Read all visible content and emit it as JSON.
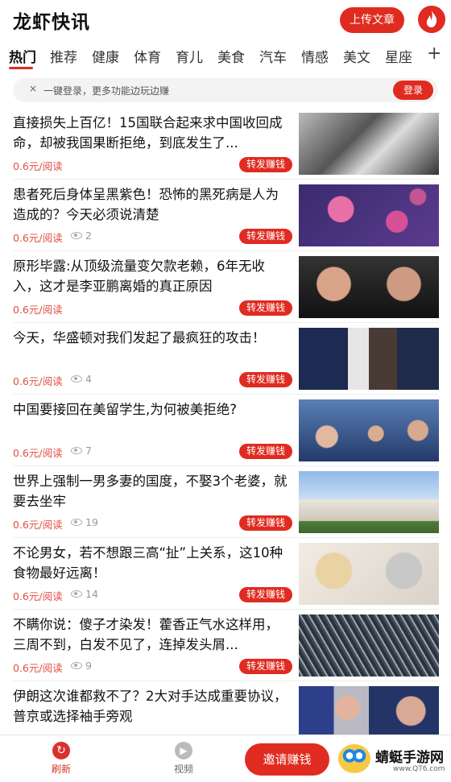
{
  "header": {
    "app_title": "龙虾快讯",
    "upload_label": "上传文章",
    "fire_icon": "fire-icon"
  },
  "tabs": {
    "items": [
      "热门",
      "推荐",
      "健康",
      "体育",
      "育儿",
      "美食",
      "汽车",
      "情感",
      "美文",
      "星座"
    ],
    "active_index": 0,
    "add_label": "+"
  },
  "login_bar": {
    "close_label": "×",
    "text": "一键登录，更多功能边玩边赚",
    "button_label": "登录"
  },
  "feed": {
    "share_label": "转发赚钱",
    "items": [
      {
        "title": "直接损失上百亿！15国联合起来求中国收回成命，却被我国果断拒绝，到底发生了...",
        "meta": "0.6元/阅读",
        "views": ""
      },
      {
        "title": "患者死后身体呈黑紫色！恐怖的黑死病是人为造成的？今天必须说清楚",
        "meta": "0.6元/阅读",
        "views": "2"
      },
      {
        "title": "原形毕露:从顶级流量变欠款老赖，6年无收入，这才是李亚鹏离婚的真正原因",
        "meta": "0.6元/阅读",
        "views": ""
      },
      {
        "title": "今天，华盛顿对我们发起了最疯狂的攻击！",
        "meta": "0.6元/阅读",
        "views": "4"
      },
      {
        "title": "中国要接回在美留学生,为何被美拒绝?",
        "meta": "0.6元/阅读",
        "views": "7"
      },
      {
        "title": "世界上强制一男多妻的国度，不娶3个老婆，就要去坐牢",
        "meta": "0.6元/阅读",
        "views": "19"
      },
      {
        "title": "不论男女，若不想跟三高“扯”上关系，这10种食物最好远离！",
        "meta": "0.6元/阅读",
        "views": "14"
      },
      {
        "title": "不瞒你说：傻子才染发！藿香正气水这样用，三周不到，白发不见了，连掉发头屑...",
        "meta": "0.6元/阅读",
        "views": "9"
      },
      {
        "title": "伊朗这次谁都救不了？2大对手达成重要协议，普京或选择袖手旁观",
        "meta": "",
        "views": ""
      }
    ]
  },
  "bottom_nav": {
    "refresh_label": "刷新",
    "refresh_icon": "refresh-icon",
    "video_label": "视频",
    "video_icon": "video-icon",
    "invite_label": "邀请赚钱"
  },
  "watermark": {
    "text": "蜻蜓手游网",
    "url": "www.QT6.com"
  },
  "colors": {
    "accent": "#e02b20",
    "meta_text": "#e05040"
  }
}
